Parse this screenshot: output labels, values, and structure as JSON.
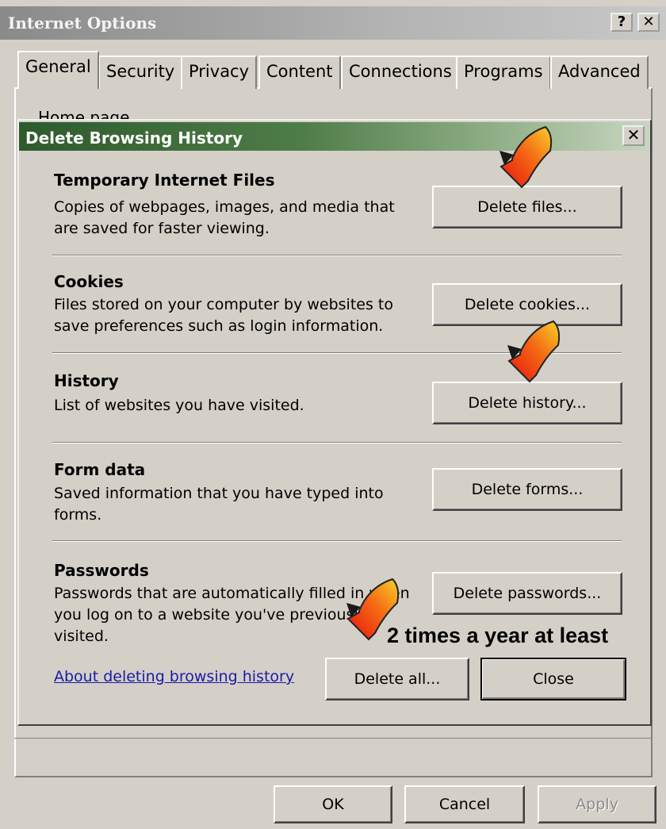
{
  "outer_window": {
    "title": "Internet Options",
    "help_button": "?",
    "close_button": "✕",
    "tabs": [
      "General",
      "Security",
      "Privacy",
      "Content",
      "Connections",
      "Programs",
      "Advanced"
    ],
    "home_page_label": "Home page",
    "ok": "OK",
    "cancel": "Cancel",
    "apply": "Apply"
  },
  "dialog": {
    "title": "Delete Browsing History",
    "close_button": "✕",
    "sections": [
      {
        "title": "Temporary Internet Files",
        "description": "Copies of webpages, images, and media that are saved for faster viewing.",
        "button": "Delete files..."
      },
      {
        "title": "Cookies",
        "description": "Files stored on your computer by websites to save preferences such as login information.",
        "button": "Delete cookies..."
      },
      {
        "title": "History",
        "description": "List of websites you have visited.",
        "button": "Delete history..."
      },
      {
        "title": "Form data",
        "description": "Saved information that you have typed into forms.",
        "button": "Delete forms..."
      },
      {
        "title": "Passwords",
        "description": "Passwords that are automatically filled in when you log on to a website you've previously visited.",
        "button": "Delete passwords..."
      }
    ],
    "about_link": "About deleting browsing history",
    "delete_all": "Delete all...",
    "close": "Close"
  },
  "annotation": {
    "text": "2 times a year at least",
    "arrow_icon": "red-checkmark-arrow-icon",
    "arrow_color": "#e8231a"
  }
}
